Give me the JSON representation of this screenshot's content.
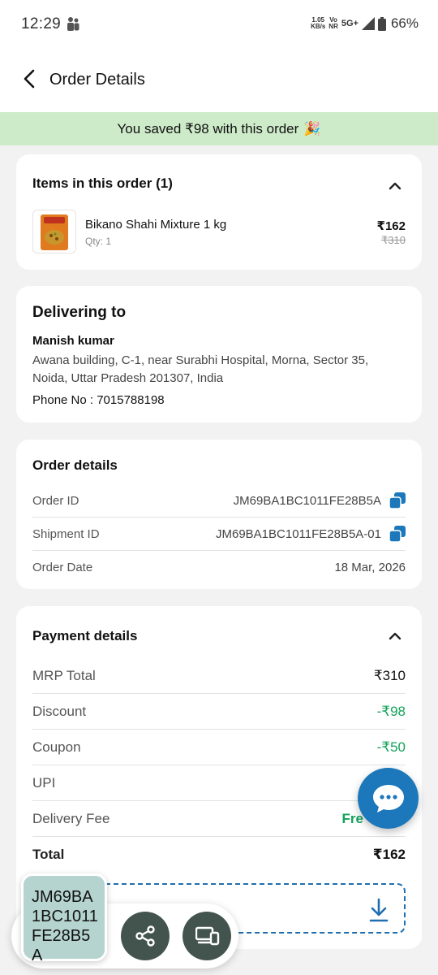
{
  "status": {
    "time": "12:29",
    "net_speed_value": "1.05",
    "net_speed_unit": "KB/s",
    "volte_line1": "Vo",
    "volte_line2": "NR",
    "network": "5G+",
    "battery": "66%"
  },
  "header": {
    "title": "Order Details"
  },
  "banner": {
    "text": "You saved ₹98 with this order",
    "emoji": "🎉"
  },
  "items_section": {
    "title": "Items in this order (1)",
    "items": [
      {
        "name": "Bikano Shahi Mixture 1 kg",
        "qty": "Qty: 1",
        "price": "₹162",
        "mrp": "₹310"
      }
    ]
  },
  "delivery": {
    "title": "Delivering to",
    "name": "Manish kumar",
    "address": "Awana building, C-1, near Surabhi Hospital, Morna, Sector 35, Noida, Uttar Pradesh 201307, India",
    "phone": "Phone No : 7015788198"
  },
  "order_details": {
    "title": "Order details",
    "rows": [
      {
        "label": "Order ID",
        "value": "JM69BA1BC1011FE28B5A"
      },
      {
        "label": "Shipment ID",
        "value": "JM69BA1BC1011FE28B5A-01"
      },
      {
        "label": "Order Date",
        "value": "18 Mar, 2026"
      }
    ]
  },
  "payment": {
    "title": "Payment details",
    "rows": [
      {
        "label": "MRP Total",
        "value": "₹310"
      },
      {
        "label": "Discount",
        "value": "-₹98"
      },
      {
        "label": "Coupon",
        "value": "-₹50"
      },
      {
        "label": "UPI",
        "value": ""
      },
      {
        "label": "Delivery Fee",
        "value": "Fre"
      },
      {
        "label": "Total",
        "value": "₹162"
      }
    ],
    "invoice_label": ""
  },
  "clipboard_chip": {
    "text": "JM69BA1BC1011FE28B5A"
  },
  "colors": {
    "accent": "#1c78ba",
    "banner": "#cdebc9",
    "green": "#13a35a",
    "fab_dark": "#43544f"
  }
}
